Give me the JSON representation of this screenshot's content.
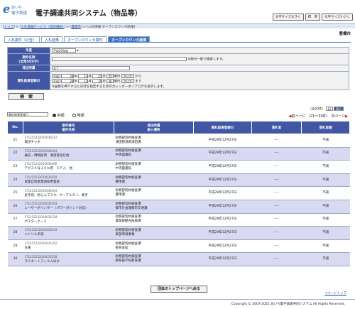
{
  "logo": {
    "e": "e",
    "line1": "あいち",
    "line2": "電子調達"
  },
  "app_title": "電子調達共同システム（物品等）",
  "header_buttons": [
    "文字サイズ大きく",
    "標　準",
    "文字サイズ小さく"
  ],
  "breadcrumb": {
    "l1": "トップ",
    "l2": "入札情報サービス（団体選択）",
    "l3": "豊橋市",
    "current": "入札情報-オープンカウンタ結果"
  },
  "city": "豊橋市",
  "tabs": [
    "入札案件（公告）",
    "入札結果",
    "オープンカウンタ案件",
    "オープンカウンタ結果"
  ],
  "form": {
    "year_label": "年度",
    "year_value": "平成29年度",
    "case_label": "案件名称",
    "case_note": "(全角50文字)",
    "case_hint": "※部分一致で検索します。",
    "dept_label": "発注所属",
    "dept_value": "全て",
    "date_label": "開札結果登録日",
    "from": {
      "era": "平成",
      "y": "29",
      "m": "12",
      "d": "25",
      "btn": "月",
      "unit_y": "年",
      "unit_m": "月",
      "unit_d": "日",
      "cal": "曜日",
      "clear": "クリア",
      "suffix": "から"
    },
    "to": {
      "era": "平成",
      "y": "29",
      "m": "12",
      "d": "29",
      "btn": "金",
      "unit_y": "年",
      "unit_m": "月",
      "unit_d": "日",
      "cal": "曜日",
      "clear": "クリア",
      "suffix": "まで"
    },
    "cal_note": "※画像を押下すると日付を指定するためのカレンダーダイアログを表示します。",
    "search_btn": "検　索"
  },
  "sort": {
    "select": "開札結果登録日",
    "asc": "昇順",
    "desc": "降順"
  },
  "count": {
    "text": "（全20件）",
    "per": "10",
    "display": "表示"
  },
  "pager": {
    "prev": "前ページ",
    "range": "（21～30件）",
    "next": "次ページ"
  },
  "grid": {
    "headers": [
      "No.",
      "案件番号\n案件名称",
      "発注所属\n納入場所",
      "開札結果登録日",
      "落札者",
      "落札金額"
    ],
    "rows": [
      {
        "no": "21",
        "num": "171215232010036312",
        "name": "電池チャネ",
        "dept": "財務部契約検査課",
        "place": "浦田部道路浦田課",
        "date": "平成29年12月27日",
        "winner": "----",
        "price": "不調"
      },
      {
        "no": "22",
        "num": "171215232010036404",
        "name": "乗前・博物館用　清潔管化灯他",
        "dept": "財務部契約検査課",
        "place": "中央図書館",
        "date": "平成29年12月27日",
        "winner": "----",
        "price": "不調"
      },
      {
        "no": "23",
        "num": "171215232010036406",
        "name": "テグス４号１０ｍ巻　５Ｐ入　他",
        "dept": "財務部契約検査課",
        "place": "中央図書館",
        "date": "平成29年12月27日",
        "winner": "----",
        "price": "不調"
      },
      {
        "no": "24",
        "num": "171215232010036410",
        "name": "収集自程家業週知用着板",
        "dept": "財務部契約検査課",
        "place": "費用課",
        "date": "平成29年12月27日",
        "winner": "----",
        "price": "不調"
      },
      {
        "no": "25",
        "num": "171215232010036403",
        "name": "皮手袋、防じんマスク、ケーブルタイ、軍手",
        "dept": "財務部契約検査課",
        "place": "費用課",
        "date": "平成29年12月27日",
        "winner": "----",
        "price": "不調"
      },
      {
        "no": "26",
        "num": "171215232010035593",
        "name": "レーザーポインター（パワーポイント対応）",
        "dept": "財務部契約検査課",
        "place": "都市計画課都市交通課",
        "date": "平成29年12月27日",
        "winner": "----",
        "price": "不調"
      },
      {
        "no": "27",
        "num": "171215232010035324",
        "name": "ポスターケース",
        "dept": "財務部契約検査課",
        "place": "農業部観光振興課",
        "date": "平成29年12月27日",
        "winner": "----",
        "price": "不調"
      },
      {
        "no": "28",
        "num": "171215232010036434",
        "name": "ニトリル手袋",
        "dept": "財務部契約検査課",
        "place": "東部環境事業",
        "date": "平成29年12月27日",
        "winner": "----",
        "price": "不調"
      },
      {
        "no": "29",
        "num": "171215232010035352",
        "name": "台車",
        "dept": "財務部契約検査課",
        "place": "教育会館",
        "date": "平成29年12月27日",
        "winner": "----",
        "price": "不調"
      },
      {
        "no": "30",
        "num": "171215232010035358",
        "name": "ラミネートフィルムほか",
        "dept": "財務部契約検査課",
        "place": "教育部学校教育課",
        "date": "平成29年12月27日",
        "winner": "----",
        "price": "不調"
      }
    ]
  },
  "back_btn": "団体のトップページへ戻る",
  "page_top": "↑ページトップ",
  "footer": "Copyright © 2007-2021 あいち電子調達共同システム All Rights Reserved."
}
